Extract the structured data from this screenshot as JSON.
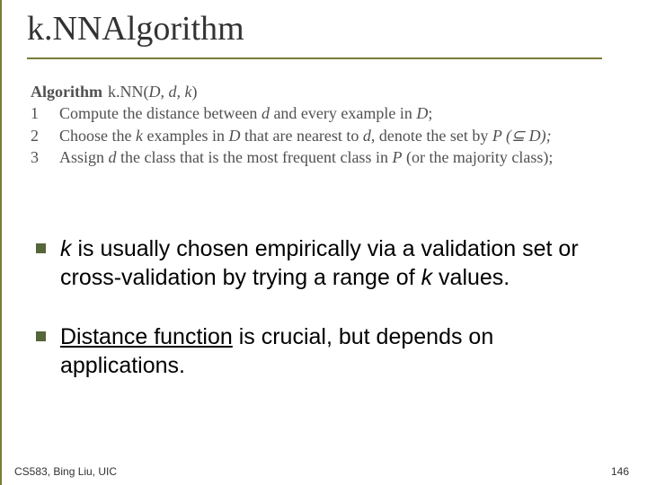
{
  "title": "k.NNAlgorithm",
  "algorithm": {
    "header_word": "Algorithm",
    "fn_name": " k.NN(",
    "args": "D, d, k",
    "close_paren": ")",
    "steps": [
      {
        "n": "1",
        "pre": "Compute the distance between ",
        "it1": "d",
        "mid": " and every example in ",
        "it2": "D",
        "post": ";"
      },
      {
        "n": "2",
        "pre": "Choose the ",
        "it1": "k",
        "mid": " examples in ",
        "it2": "D",
        "mid2": " that are nearest to ",
        "it3": "d",
        "post_set": ", denote the set by ",
        "p_expr": "P (⊆ D);"
      },
      {
        "n": "3",
        "pre": "Assign ",
        "it1": "d",
        "mid": " the class that is the most frequent class in ",
        "it2": "P",
        "post": " (or the majority class);"
      }
    ]
  },
  "bullets": [
    {
      "runs": [
        {
          "t": "k",
          "it": true
        },
        {
          "t": " is usually chosen empirically via a validation set or cross-validation by trying a range of "
        },
        {
          "t": "k",
          "it": true
        },
        {
          "t": " values."
        }
      ]
    },
    {
      "runs": [
        {
          "t": "Distance function",
          "ul": true
        },
        {
          "t": " is crucial, but depends on applications."
        }
      ]
    }
  ],
  "footer": "CS583, Bing Liu, UIC",
  "page": "146"
}
